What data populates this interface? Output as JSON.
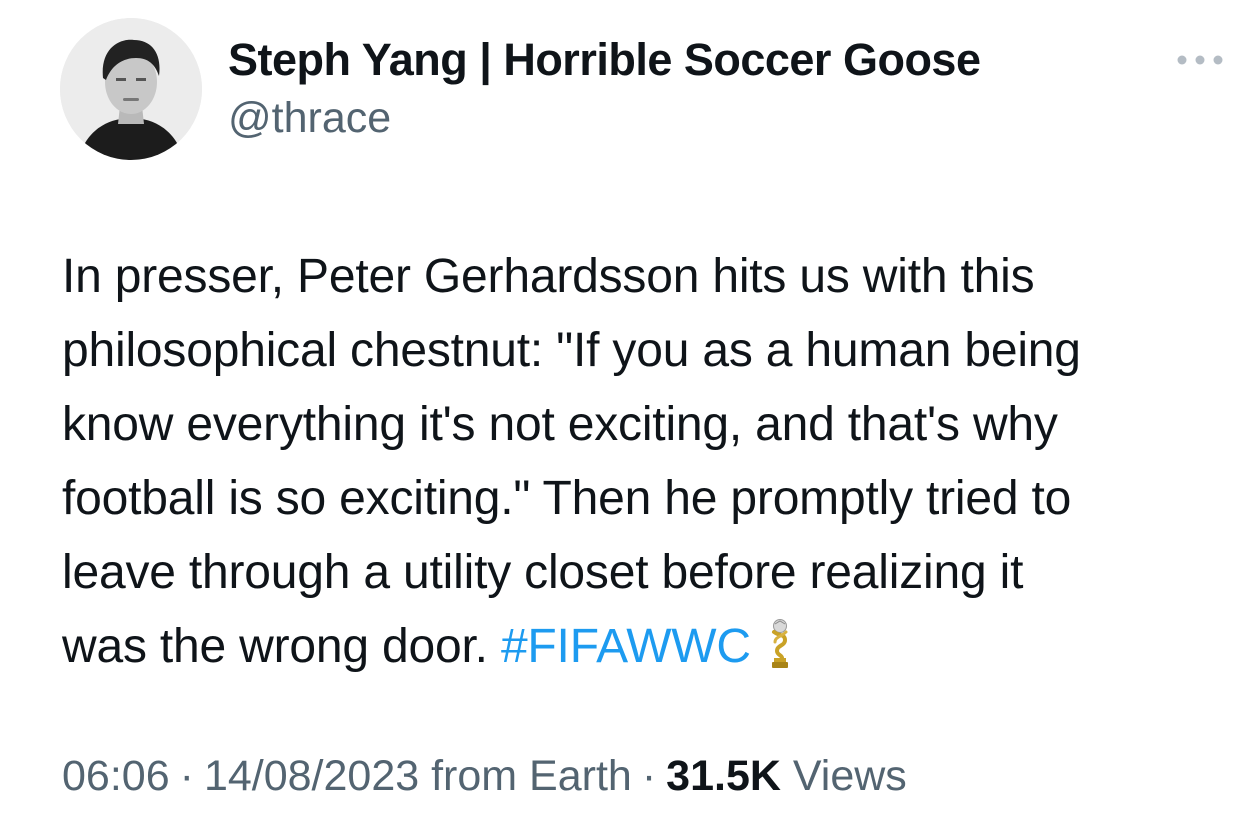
{
  "author": {
    "display_name": "Steph Yang | Horrible Soccer Goose",
    "handle": "@thrace",
    "avatar_icon": "person-photo-avatar"
  },
  "more_icon": "more-horizontal-icon",
  "tweet": {
    "lines": [
      "In presser, Peter Gerhardsson hits us with this",
      "philosophical chestnut: \"If you as a human being",
      "know everything it's not exciting, and that's why",
      "football is so exciting.\" Then he promptly tried to",
      "leave through a utility closet before realizing it",
      "was the wrong door."
    ],
    "hashtag": "#FIFAWWC",
    "emoji_icon": "trophy-icon"
  },
  "meta": {
    "time": "06:06",
    "date": "14/08/2023",
    "source": "from Earth",
    "separator": "·",
    "views_count": "31.5K",
    "views_label": "Views"
  },
  "colors": {
    "text": "#0f1419",
    "secondary": "#536471",
    "link": "#1d9bf0"
  }
}
